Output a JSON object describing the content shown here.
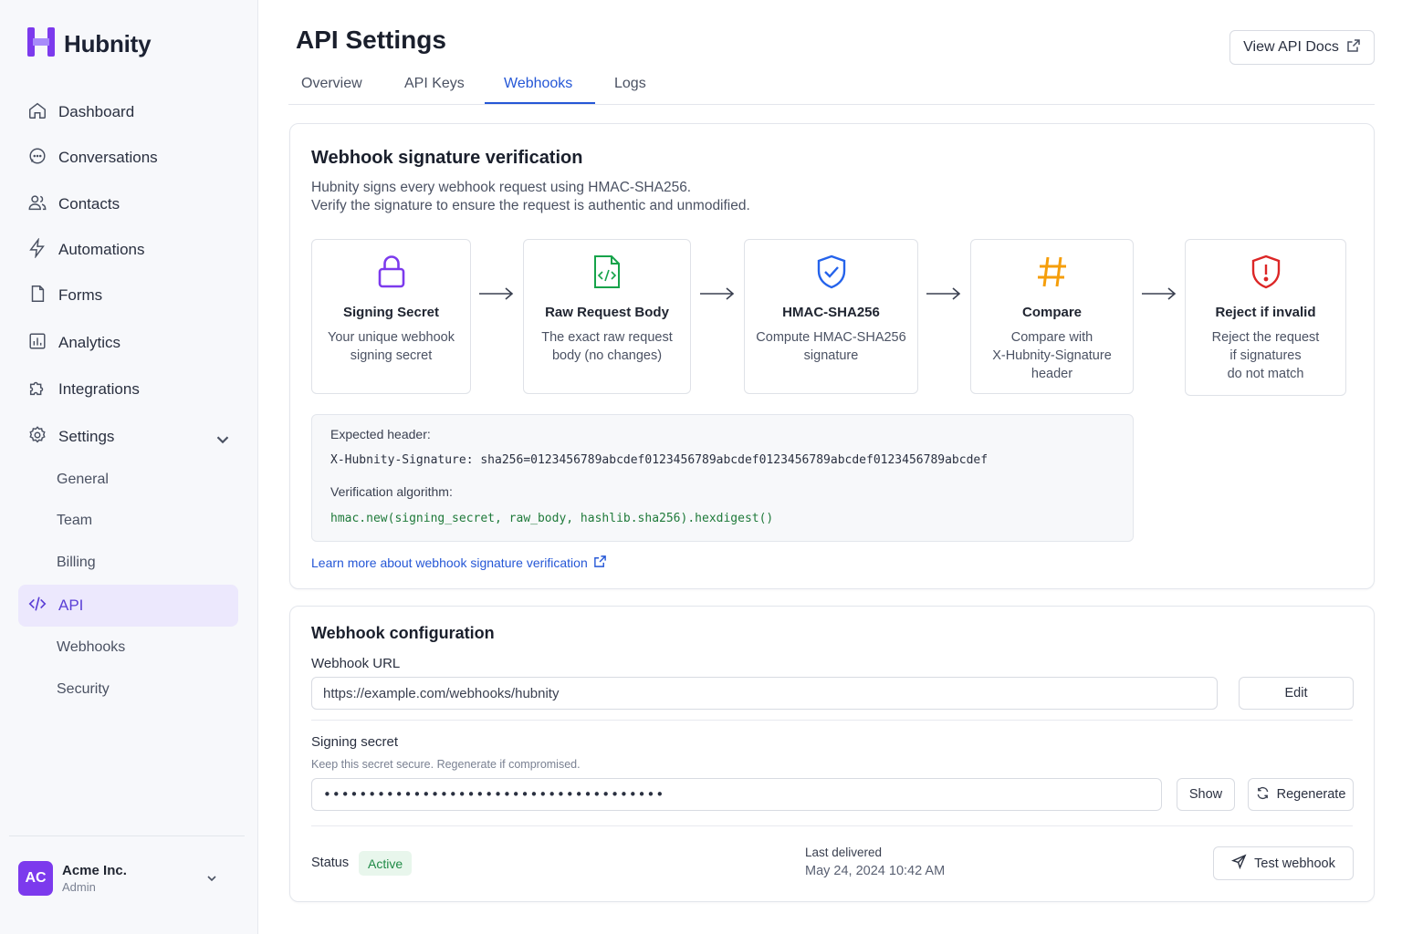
{
  "brand": {
    "name": "Hubnity",
    "accent": "#7c3aed"
  },
  "sidebar": {
    "items": [
      {
        "label": "Dashboard",
        "icon": "home-icon"
      },
      {
        "label": "Conversations",
        "icon": "chat-icon"
      },
      {
        "label": "Contacts",
        "icon": "users-icon"
      },
      {
        "label": "Automations",
        "icon": "bolt-icon"
      },
      {
        "label": "Forms",
        "icon": "document-icon"
      },
      {
        "label": "Analytics",
        "icon": "bar-chart-icon"
      },
      {
        "label": "Integrations",
        "icon": "puzzle-icon"
      },
      {
        "label": "Settings",
        "icon": "gear-icon"
      }
    ],
    "settings_sub": [
      "General",
      "Team",
      "Billing"
    ],
    "active_item": {
      "label": "API",
      "icon": "code-icon"
    },
    "api_sub": [
      "Webhooks",
      "Security"
    ]
  },
  "account": {
    "initials": "AC",
    "name": "Acme Inc.",
    "role": "Admin"
  },
  "header": {
    "title": "API Settings",
    "docs_button": "View API Docs",
    "tabs": [
      "Overview",
      "API Keys",
      "Webhooks",
      "Logs"
    ],
    "active_tab": "Webhooks"
  },
  "verification": {
    "title": "Webhook signature verification",
    "description_line1": "Hubnity signs every webhook request using HMAC-SHA256.",
    "description_line2": "Verify the signature to ensure the request is authentic and unmodified.",
    "steps": [
      {
        "title": "Signing Secret",
        "desc_line1": "Your unique webhook",
        "desc_line2": "signing secret",
        "desc_line3": "",
        "icon": "lock-icon",
        "color": "#7c3aed"
      },
      {
        "title": "Raw Request Body",
        "desc_line1": "The exact raw request",
        "desc_line2": "body (no changes)",
        "desc_line3": "",
        "icon": "code-file-icon",
        "color": "#16a34a"
      },
      {
        "title": "HMAC-SHA256",
        "desc_line1": "Compute HMAC-SHA256",
        "desc_line2": "signature",
        "desc_line3": "",
        "icon": "shield-check-icon",
        "color": "#2563eb"
      },
      {
        "title": "Compare",
        "desc_line1": "Compare with",
        "desc_line2": "X-Hubnity-Signature",
        "desc_line3": "header",
        "icon": "hash-icon",
        "color": "#f59e0b"
      },
      {
        "title": "Reject if invalid",
        "desc_line1": "Reject the request",
        "desc_line2": "if signatures",
        "desc_line3": "do not match",
        "icon": "shield-alert-icon",
        "color": "#dc2626"
      }
    ],
    "expected_header_label": "Expected header:",
    "expected_header_code": "X-Hubnity-Signature: sha256=0123456789abcdef0123456789abcdef0123456789abcdef0123456789abcdef",
    "algorithm_label": "Verification algorithm:",
    "algorithm_code": "hmac.new(signing_secret, raw_body, hashlib.sha256).hexdigest()",
    "learn_more": "Learn more about webhook signature verification"
  },
  "config": {
    "title": "Webhook configuration",
    "url_label": "Webhook URL",
    "url_value": "https://example.com/webhooks/hubnity",
    "edit_button": "Edit",
    "secret_label": "Signing secret",
    "secret_help": "Keep this secret secure. Regenerate if compromised.",
    "secret_value": "••••••••••••••••••••••••••••••••••••••",
    "show_button": "Show",
    "regenerate_button": "Regenerate",
    "status_label": "Status",
    "status_value": "Active",
    "last_delivered_label": "Last delivered",
    "last_delivered_value": "May 24, 2024 10:42 AM",
    "test_button": "Test webhook"
  }
}
